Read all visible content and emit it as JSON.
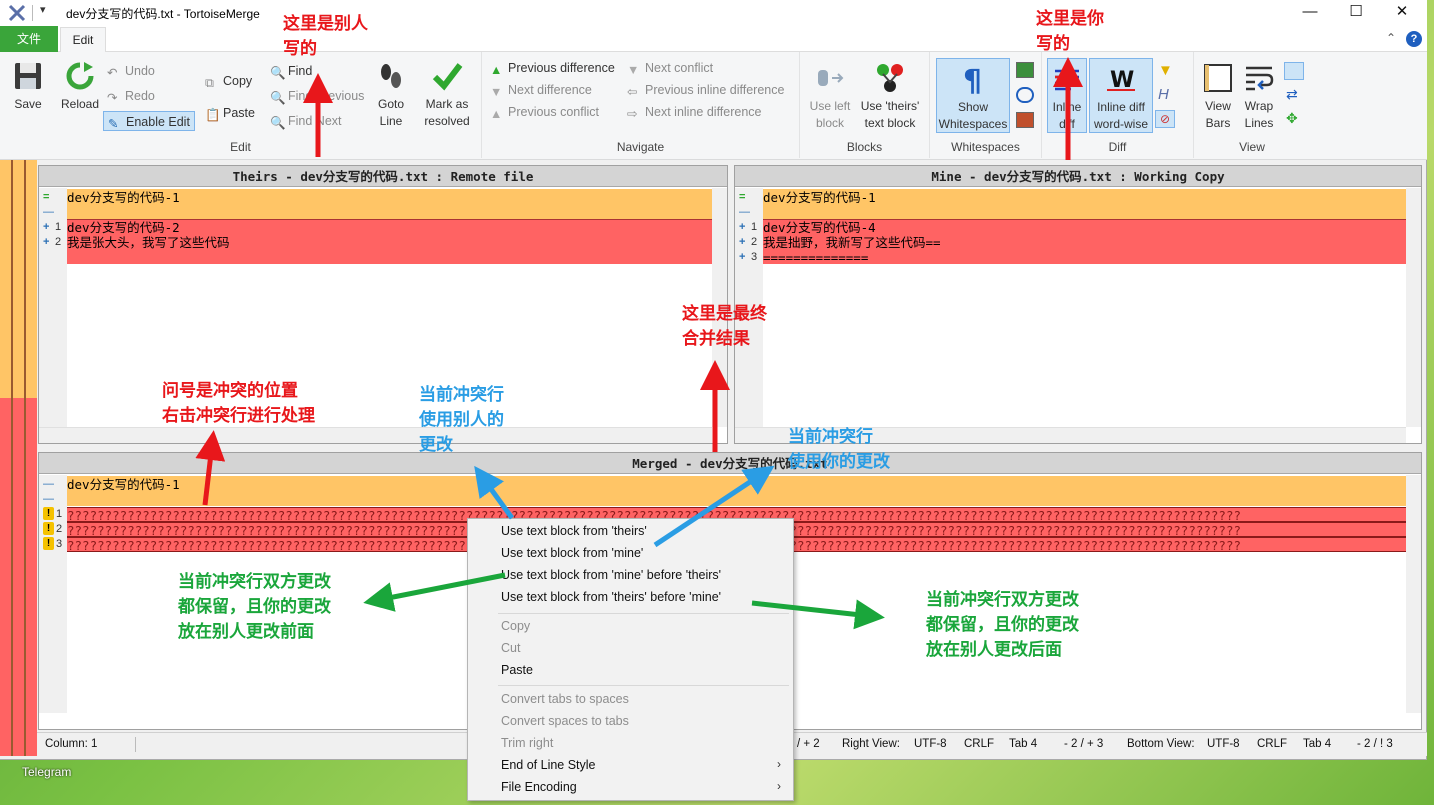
{
  "window": {
    "title": "dev分支写的代码.txt - TortoiseMerge",
    "minimize": "—",
    "maximize": "☐",
    "close": "✕"
  },
  "ribbon_tabs": {
    "file": "文件",
    "edit": "Edit"
  },
  "ribbon": {
    "edit_group": {
      "label": "Edit",
      "save": "Save",
      "reload": "Reload",
      "undo": "Undo",
      "redo": "Redo",
      "enable_edit": "Enable Edit",
      "copy": "Copy",
      "paste": "Paste",
      "find": "Find",
      "find_previous": "Find Previous",
      "find_next": "Find Next",
      "goto_line": "Goto Line",
      "mark_resolved": "Mark as resolved"
    },
    "navigate_group": {
      "label": "Navigate",
      "previous_difference": "Previous difference",
      "next_difference": "Next difference",
      "previous_conflict": "Previous conflict",
      "next_conflict": "Next conflict",
      "previous_inline": "Previous inline difference",
      "next_inline": "Next inline difference"
    },
    "blocks_group": {
      "label": "Blocks",
      "use_left": "Use left block",
      "use_theirs": "Use 'theirs' text block"
    },
    "whitespaces_group": {
      "label": "Whitespaces",
      "show": "Show Whitespaces"
    },
    "diff_group": {
      "label": "Diff",
      "inline": "Inline diff",
      "inline_word": "Inline diff word-wise"
    },
    "view_group": {
      "label": "View",
      "view_bars": "View Bars",
      "wrap_lines": "Wrap Lines"
    }
  },
  "theirs_pane": {
    "header": "Theirs - dev分支写的代码.txt : Remote file",
    "lines": [
      {
        "mark": "=",
        "num": "",
        "text": "dev分支写的代码-1"
      },
      {
        "mark": "—",
        "num": "",
        "text": ""
      },
      {
        "mark": "+",
        "num": "1",
        "text": "dev分支写的代码-2"
      },
      {
        "mark": "+",
        "num": "2",
        "text": "我是张大头，我写了这些代码"
      }
    ]
  },
  "mine_pane": {
    "header": "Mine - dev分支写的代码.txt : Working Copy",
    "lines": [
      {
        "mark": "=",
        "num": "",
        "text": "dev分支写的代码-1"
      },
      {
        "mark": "—",
        "num": "",
        "text": ""
      },
      {
        "mark": "+",
        "num": "1",
        "text": "dev分支写的代码-4"
      },
      {
        "mark": "+",
        "num": "2",
        "text": "我是拙野，我新写了这些代码=="
      },
      {
        "mark": "+",
        "num": "3",
        "text": "=============="
      }
    ]
  },
  "merged_pane": {
    "header": "Merged - dev分支写的代码.txt",
    "lines": [
      {
        "mark": "—",
        "num": "",
        "text": "dev分支写的代码-1"
      },
      {
        "mark": "—",
        "num": "",
        "text": ""
      },
      {
        "mark": "!",
        "num": "1",
        "text": "????????????????????????????????????????????????????????????????????????????????????????????????????????????????????????????????????????????????????????????"
      },
      {
        "mark": "!",
        "num": "2",
        "text": "????????????????????????????????????????????????????????????????????????????????????????????????????????????????????????????????????????????????????????????"
      },
      {
        "mark": "!",
        "num": "3",
        "text": "????????????????????????????????????????????????????????????????????????????????????????????????????????????????????????????????????????????????????????????"
      }
    ]
  },
  "status": {
    "column": "Column: 1",
    "left_counts": "/ + 2",
    "right_view_label": "Right View:",
    "right_encoding": "UTF-8",
    "right_eol": "CRLF",
    "right_tab": "Tab 4",
    "right_counts": "- 2 / + 3",
    "bottom_view_label": "Bottom View:",
    "bottom_encoding": "UTF-8",
    "bottom_eol": "CRLF",
    "bottom_tab": "Tab 4",
    "bottom_counts": "- 2 / ! 3"
  },
  "context_menu": {
    "items": [
      "Use text block from 'theirs'",
      "Use text block from 'mine'",
      "Use text block from 'mine' before 'theirs'",
      "Use text block from 'theirs' before 'mine'",
      "Copy",
      "Cut",
      "Paste",
      "Convert tabs to spaces",
      "Convert spaces to tabs",
      "Trim right",
      "End of Line Style",
      "File Encoding"
    ]
  },
  "taskbar": {
    "telegram": "Telegram"
  },
  "annotations": {
    "others_wrote_1": "这里是别人",
    "others_wrote_2": "写的",
    "you_wrote_1": "这里是你",
    "you_wrote_2": "写的",
    "final_merge_1": "这里是最终",
    "final_merge_2": "合并结果",
    "question_1": "问号是冲突的位置",
    "question_2": "右击冲突行进行处理",
    "use_others_1": "当前冲突行",
    "use_others_2": "使用别人的",
    "use_others_3": "更改",
    "use_yours_1": "当前冲突行",
    "use_yours_2": "使用你的更改",
    "keep_before_1": "当前冲突行双方更改",
    "keep_before_2": "都保留，且你的更改",
    "keep_before_3": "放在别人更改前面",
    "keep_after_1": "当前冲突行双方更改",
    "keep_after_2": "都保留，且你的更改",
    "keep_after_3": "放在别人更改后面"
  },
  "colors": {
    "conflict_red": "#ff6363",
    "same_orange": "#ffc566",
    "file_tab_green": "#3aa53a"
  }
}
